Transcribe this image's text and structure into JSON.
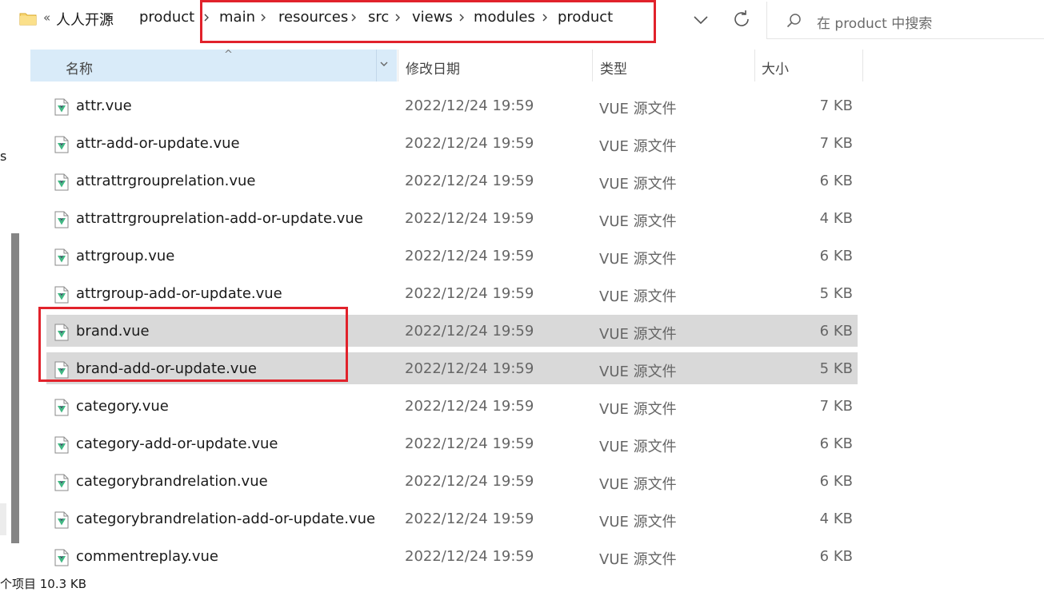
{
  "address_bar": {
    "overflow_label": "«",
    "crumbs": [
      "人人开源",
      "product",
      "main",
      "resources",
      "src",
      "views",
      "modules",
      "product"
    ]
  },
  "search": {
    "placeholder": "在 product 中搜索"
  },
  "columns": {
    "name": "名称",
    "date": "修改日期",
    "type": "类型",
    "size": "大小"
  },
  "files": [
    {
      "name": "attr.vue",
      "date": "2022/12/24 19:59",
      "type": "VUE 源文件",
      "size": "7 KB",
      "selected": false
    },
    {
      "name": "attr-add-or-update.vue",
      "date": "2022/12/24 19:59",
      "type": "VUE 源文件",
      "size": "7 KB",
      "selected": false
    },
    {
      "name": "attrattrgrouprelation.vue",
      "date": "2022/12/24 19:59",
      "type": "VUE 源文件",
      "size": "6 KB",
      "selected": false
    },
    {
      "name": "attrattrgrouprelation-add-or-update.vue",
      "date": "2022/12/24 19:59",
      "type": "VUE 源文件",
      "size": "4 KB",
      "selected": false
    },
    {
      "name": "attrgroup.vue",
      "date": "2022/12/24 19:59",
      "type": "VUE 源文件",
      "size": "6 KB",
      "selected": false
    },
    {
      "name": "attrgroup-add-or-update.vue",
      "date": "2022/12/24 19:59",
      "type": "VUE 源文件",
      "size": "5 KB",
      "selected": false
    },
    {
      "name": "brand.vue",
      "date": "2022/12/24 19:59",
      "type": "VUE 源文件",
      "size": "6 KB",
      "selected": true
    },
    {
      "name": "brand-add-or-update.vue",
      "date": "2022/12/24 19:59",
      "type": "VUE 源文件",
      "size": "5 KB",
      "selected": true
    },
    {
      "name": "category.vue",
      "date": "2022/12/24 19:59",
      "type": "VUE 源文件",
      "size": "7 KB",
      "selected": false
    },
    {
      "name": "category-add-or-update.vue",
      "date": "2022/12/24 19:59",
      "type": "VUE 源文件",
      "size": "6 KB",
      "selected": false
    },
    {
      "name": "categorybrandrelation.vue",
      "date": "2022/12/24 19:59",
      "type": "VUE 源文件",
      "size": "6 KB",
      "selected": false
    },
    {
      "name": "categorybrandrelation-add-or-update.vue",
      "date": "2022/12/24 19:59",
      "type": "VUE 源文件",
      "size": "4 KB",
      "selected": false
    },
    {
      "name": "commentreplay.vue",
      "date": "2022/12/24 19:59",
      "type": "VUE 源文件",
      "size": "6 KB",
      "selected": false
    }
  ],
  "left_pane": {
    "clipped_letter": "s"
  },
  "status_bar": {
    "text": "个项目 10.3 KB"
  },
  "colors": {
    "header_selected": "#d9ebf9",
    "row_selected": "#d9d9d9",
    "annotation_red": "#e1222b",
    "vue_green": "#41b883"
  },
  "icons": {
    "folder": "folder-icon",
    "chevron": "chevron-right-icon",
    "dropdown": "chevron-down-icon",
    "refresh": "refresh-icon",
    "search": "search-icon",
    "file": "vue-file-icon"
  }
}
